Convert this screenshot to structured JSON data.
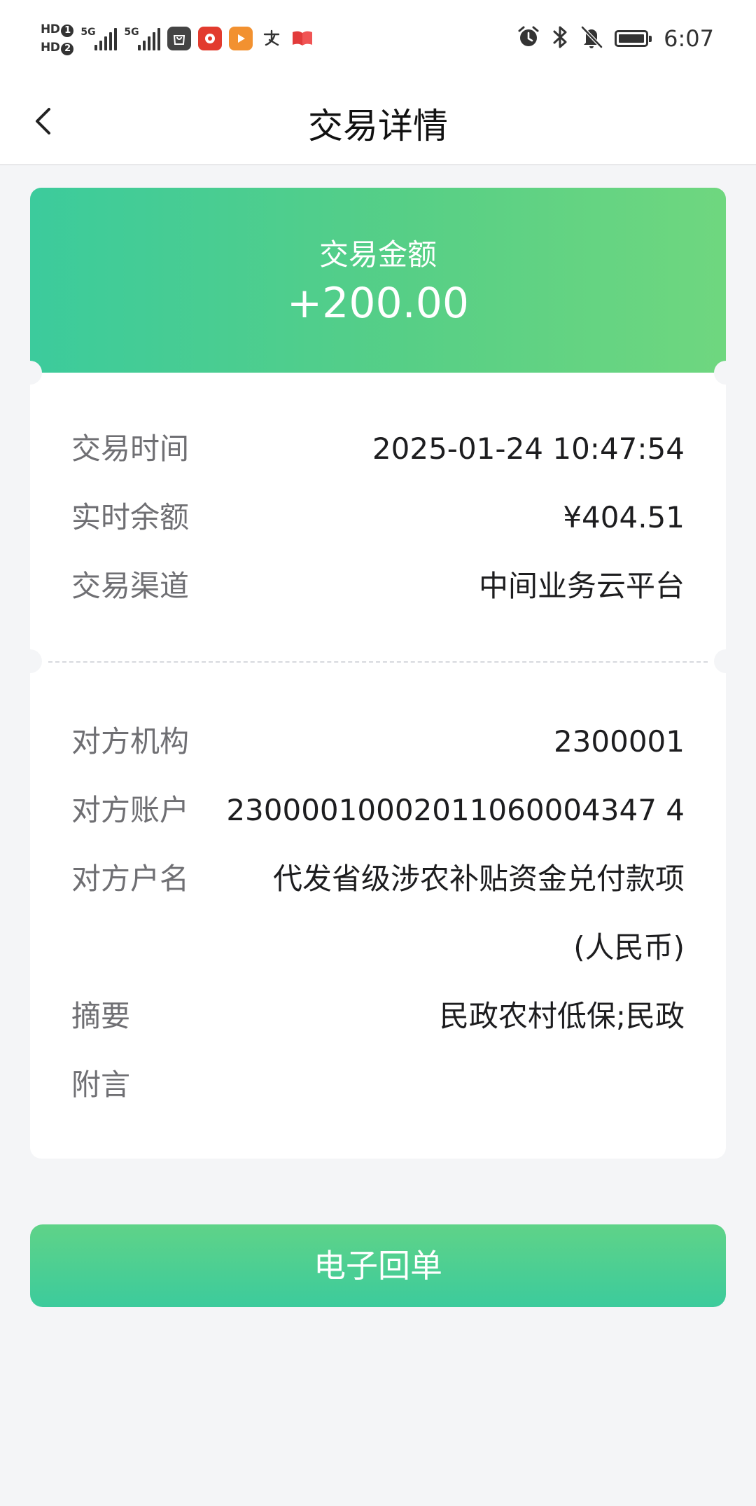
{
  "status_bar": {
    "sim1": "HD",
    "sim1_num": "1",
    "sim2": "HD",
    "sim2_num": "2",
    "net1": "5G",
    "net2": "5G",
    "time": "6:07",
    "icons": [
      "alarm-icon",
      "bluetooth-icon",
      "bell-off-icon",
      "battery-icon"
    ],
    "app_icons": [
      "shopping-bag-app-icon",
      "red-app-icon",
      "play-app-icon",
      "pay-app-icon",
      "book-app-icon"
    ]
  },
  "nav": {
    "title": "交易详情",
    "back_icon": "chevron-left-icon"
  },
  "amount": {
    "label": "交易金额",
    "value": "+200.00"
  },
  "details_1": [
    {
      "label": "交易时间",
      "value": "2025-01-24 10:47:54"
    },
    {
      "label": "实时余额",
      "value": "¥404.51"
    },
    {
      "label": "交易渠道",
      "value": "中间业务云平台"
    }
  ],
  "details_2": [
    {
      "label": "对方机构",
      "value": "2300001"
    },
    {
      "label": "对方账户",
      "value": "23000010002011060004347 4"
    },
    {
      "label": "对方户名",
      "value": "代发省级涉农补贴资金兑付款项",
      "value_line2": "(人民币)"
    },
    {
      "label": "摘要",
      "value": "民政农村低保;民政"
    },
    {
      "label": "附言",
      "value": ""
    }
  ],
  "button": {
    "label": "电子回单"
  },
  "colors": {
    "accent_start": "#3ccb9c",
    "accent_end": "#6fd77f",
    "background": "#f4f5f7",
    "label_text": "#6f6f73"
  }
}
